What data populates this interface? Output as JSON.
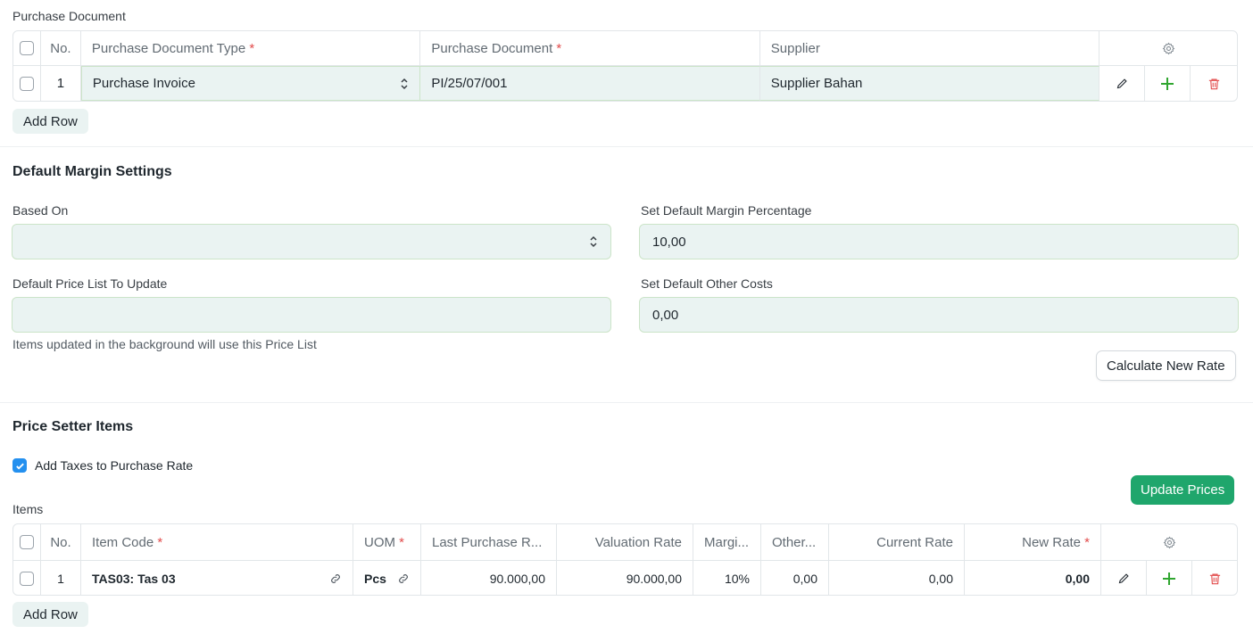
{
  "purchase_section": {
    "label": "Purchase Document",
    "columns": {
      "no": "No.",
      "doc_type": "Purchase Document Type",
      "doc": "Purchase Document",
      "supplier": "Supplier",
      "required_mark": "*"
    },
    "rows": [
      {
        "no": "1",
        "doc_type": "Purchase Invoice",
        "doc": "PI/25/07/001",
        "supplier": "Supplier Bahan"
      }
    ],
    "add_row": "Add Row"
  },
  "margin_settings": {
    "title": "Default Margin Settings",
    "based_on": {
      "label": "Based On",
      "value": ""
    },
    "margin_pct": {
      "label": "Set Default Margin Percentage",
      "value": "10,00"
    },
    "price_list": {
      "label": "Default Price List To Update",
      "value": "",
      "help": "Items updated in the background will use this Price List"
    },
    "other_costs": {
      "label": "Set Default Other Costs",
      "value": "0,00"
    },
    "calculate_button": "Calculate New Rate"
  },
  "price_setter": {
    "title": "Price Setter Items",
    "add_taxes": {
      "label": "Add Taxes to Purchase Rate",
      "checked": true
    },
    "update_button": "Update Prices",
    "items_label": "Items",
    "columns": {
      "no": "No.",
      "item_code": "Item Code",
      "uom": "UOM",
      "last_purchase": "Last Purchase R...",
      "valuation": "Valuation Rate",
      "margin": "Margi...",
      "other": "Other...",
      "current": "Current Rate",
      "new_rate": "New Rate",
      "required_mark": "*"
    },
    "rows": [
      {
        "no": "1",
        "item_code": "TAS03: Tas 03",
        "uom": "Pcs",
        "last_purchase": "90.000,00",
        "valuation": "90.000,00",
        "margin": "10%",
        "other": "0,00",
        "current": "0,00",
        "new_rate": "0,00"
      }
    ],
    "add_row": "Add Row"
  },
  "colors": {
    "accent_green": "#1fa66c",
    "checkbox_blue": "#2490ef",
    "required_red": "#e24c4c",
    "field_bg": "#eaf3f2"
  }
}
